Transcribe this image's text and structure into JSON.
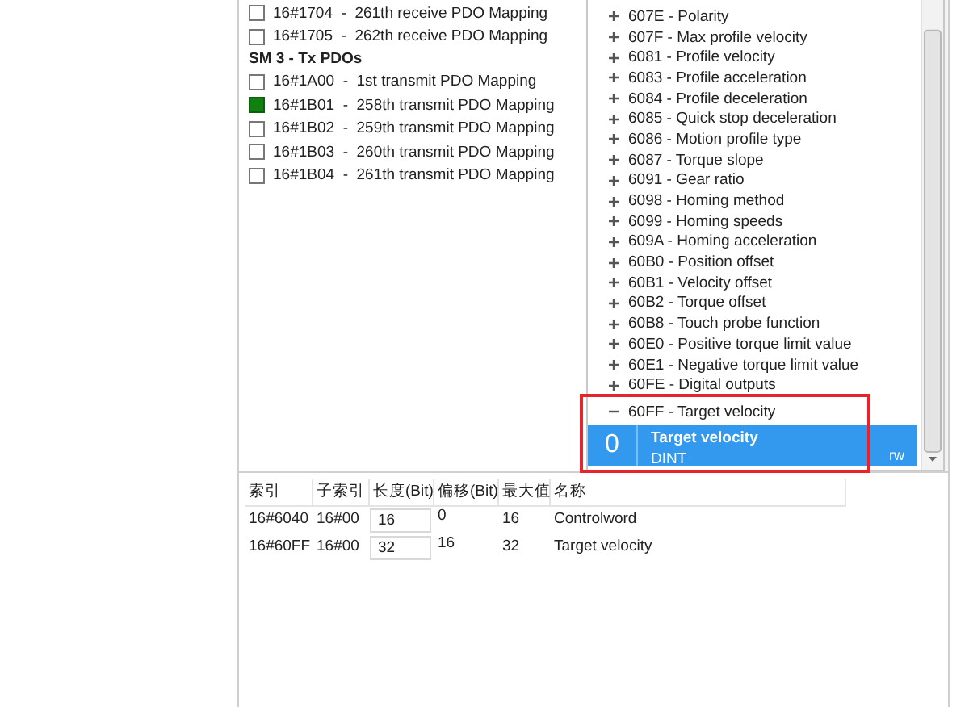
{
  "pdo_sections": [
    {
      "items": [
        {
          "label": "16#1704  -  261th receive PDO Mapping",
          "checked": false
        },
        {
          "label": "16#1705  -  262th receive PDO Mapping",
          "checked": false
        }
      ]
    },
    {
      "title": "SM 3 - Tx PDOs",
      "items": [
        {
          "label": "16#1A00  -  1st transmit PDO Mapping",
          "checked": false
        },
        {
          "label": "16#1B01  -  258th transmit PDO Mapping",
          "checked": true
        },
        {
          "label": "16#1B02  -  259th transmit PDO Mapping",
          "checked": false
        },
        {
          "label": "16#1B03  -  260th transmit PDO Mapping",
          "checked": false
        },
        {
          "label": "16#1B04  -  261th transmit PDO Mapping",
          "checked": false
        }
      ]
    }
  ],
  "object_tree": [
    {
      "label": "607E - Polarity",
      "expanded": false
    },
    {
      "label": "607F - Max profile velocity",
      "expanded": false
    },
    {
      "label": "6081 - Profile velocity",
      "expanded": false
    },
    {
      "label": "6083 - Profile acceleration",
      "expanded": false
    },
    {
      "label": "6084 - Profile deceleration",
      "expanded": false
    },
    {
      "label": "6085 - Quick stop deceleration",
      "expanded": false
    },
    {
      "label": "6086 - Motion profile type",
      "expanded": false
    },
    {
      "label": "6087 - Torque slope",
      "expanded": false
    },
    {
      "label": "6091 - Gear ratio",
      "expanded": false
    },
    {
      "label": "6098 - Homing method",
      "expanded": false
    },
    {
      "label": "6099 - Homing speeds",
      "expanded": false
    },
    {
      "label": "609A - Homing acceleration",
      "expanded": false
    },
    {
      "label": "60B0 - Position offset",
      "expanded": false
    },
    {
      "label": "60B1 - Velocity offset",
      "expanded": false
    },
    {
      "label": "60B2 - Torque offset",
      "expanded": false
    },
    {
      "label": "60B8 - Touch probe function",
      "expanded": false
    },
    {
      "label": "60E0 - Positive torque limit value",
      "expanded": false
    },
    {
      "label": "60E1 - Negative torque limit value",
      "expanded": false
    },
    {
      "label": "60FE - Digital outputs",
      "expanded": false
    },
    {
      "label": "60FF - Target velocity",
      "expanded": true,
      "highlighted": true,
      "children": [
        {
          "subindex": "0",
          "name": "Target velocity",
          "type": "DINT",
          "access": "rw",
          "selected": true
        }
      ]
    }
  ],
  "mapping_table": {
    "columns": [
      {
        "label": "索引",
        "kind": "text"
      },
      {
        "label": "子索引",
        "kind": "text"
      },
      {
        "label": "长度(Bit)",
        "kind": "input"
      },
      {
        "label": "偏移(Bit)",
        "kind": "text"
      },
      {
        "label": "最大值",
        "kind": "text"
      },
      {
        "label": "名称",
        "kind": "text"
      }
    ],
    "rows": [
      [
        "16#6040",
        "16#00",
        "16",
        "0",
        "16",
        "Controlword"
      ],
      [
        "16#60FF",
        "16#00",
        "32",
        "16",
        "32",
        "Target velocity"
      ]
    ]
  }
}
